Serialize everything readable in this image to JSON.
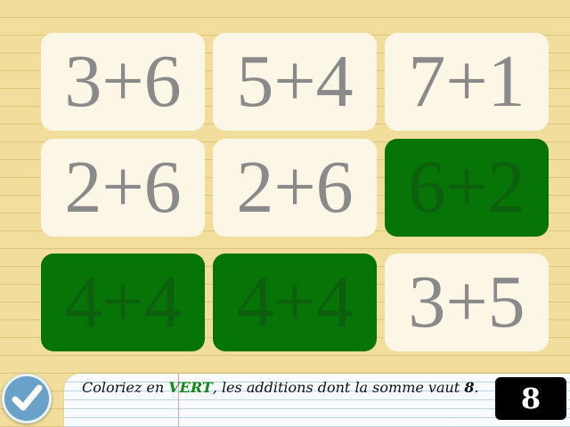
{
  "tiles": [
    {
      "label": "3+6",
      "selected": false
    },
    {
      "label": "5+4",
      "selected": false
    },
    {
      "label": "7+1",
      "selected": false
    },
    {
      "label": "2+6",
      "selected": false
    },
    {
      "label": "2+6",
      "selected": false
    },
    {
      "label": "6+2",
      "selected": true
    },
    {
      "label": "4+4",
      "selected": true
    },
    {
      "label": "4+4",
      "selected": true
    },
    {
      "label": "3+5",
      "selected": false
    }
  ],
  "instruction": {
    "part1": "Coloriez en ",
    "color_word": "VERT",
    "part2": ", les additions dont la somme vaut ",
    "target": "8",
    "end": "."
  },
  "target_value": "8",
  "check_button": {
    "icon": "check-icon"
  },
  "colors": {
    "selected_tile": "#067406",
    "unselected_tile": "#fbf6e6",
    "highlight_word": "#0e8a0e"
  }
}
